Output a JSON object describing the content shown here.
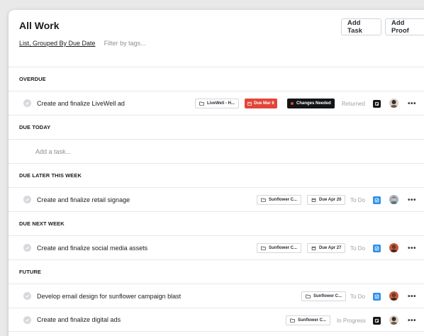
{
  "header": {
    "title": "All Work",
    "view_label": "List, Grouped By Due Date",
    "filter_placeholder": "Filter by tags...",
    "add_task_label": "Add Task",
    "add_proof_label": "Add Proof"
  },
  "sections": [
    {
      "label": "OVERDUE"
    },
    {
      "label": "DUE TODAY"
    },
    {
      "label": "DUE LATER THIS WEEK"
    },
    {
      "label": "DUE NEXT WEEK"
    },
    {
      "label": "FUTURE"
    }
  ],
  "add_task_placeholder": "Add a task...",
  "tasks": [
    {
      "name": "Create and finalize LiveWell ad",
      "project": "LiveWell - H...",
      "due": "Due Mar 6",
      "tag": "Changes Needed",
      "status": "Returned",
      "app": "black"
    },
    {
      "name": "Create and finalize retail signage",
      "project": "Sunflower C...",
      "due": "Due Apr 20",
      "status": "To Do",
      "app": "blue"
    },
    {
      "name": "Create and finalize social media assets",
      "project": "Sunflower C...",
      "due": "Due Apr 27",
      "status": "To Do",
      "app": "blue"
    },
    {
      "name": "Develop email design for sunflower campaign blast",
      "project": "Sunflower C...",
      "status": "To Do",
      "app": "blue"
    },
    {
      "name": "Create and finalize digital ads",
      "project": "Sunflower C...",
      "status": "In Progress",
      "app": "black"
    }
  ],
  "colors": {
    "overdue_red": "#e2453a",
    "accent_blue": "#2d8fe6",
    "status_gray": "#9aa0a6"
  },
  "more_label": "•••"
}
